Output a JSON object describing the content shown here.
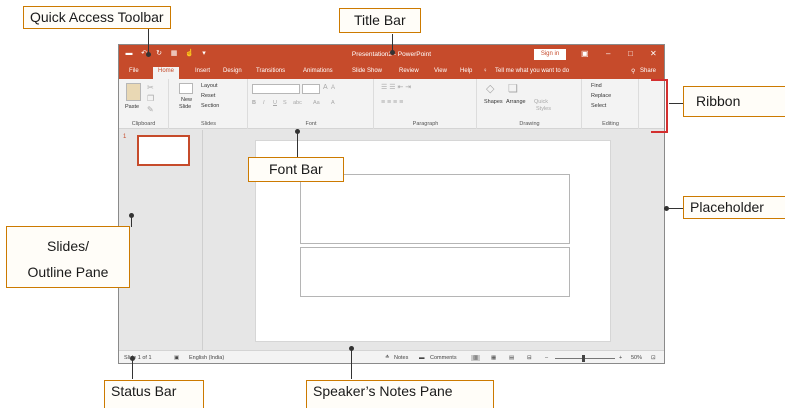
{
  "callouts": {
    "quick_access": "Quick  Access Toolbar",
    "title_bar": "Title Bar",
    "ribbon": "Ribbon",
    "placeholder": "Placeholder",
    "font_bar": "Font Bar",
    "slides_pane_line1": "Slides/",
    "slides_pane_line2": "Outline Pane",
    "status_bar": "Status Bar",
    "notes_pane": "Speaker’s Notes Pane"
  },
  "window": {
    "title": "Presentation2 - PowerPoint",
    "sign_in": "Sign in"
  },
  "tabs": [
    "File",
    "Home",
    "Insert",
    "Design",
    "Transitions",
    "Animations",
    "Slide Show",
    "Review",
    "View",
    "Help"
  ],
  "tell_me": "Tell me what you want to do",
  "share": "Share",
  "ribbon": {
    "clipboard": {
      "paste": "Paste",
      "label": "Clipboard"
    },
    "slides": {
      "new_slide_1": "New",
      "new_slide_2": "Slide",
      "layout": "Layout",
      "reset": "Reset",
      "section": "Section",
      "label": "Slides"
    },
    "font": {
      "label": "Font",
      "bold": "B",
      "italic": "I",
      "underline": "U",
      "strike": "S",
      "shadow": "abc",
      "aa": "Aa",
      "a": "A"
    },
    "paragraph": {
      "label": "Paragraph"
    },
    "drawing": {
      "shapes": "Shapes",
      "arrange": "Arrange",
      "quick_1": "Quick",
      "quick_2": "Styles",
      "label": "Drawing"
    },
    "editing": {
      "find": "Find",
      "replace": "Replace",
      "select": "Select",
      "label": "Editing"
    }
  },
  "thumbnail": {
    "number": "1"
  },
  "statusbar": {
    "slide_info": "Slide 1 of 1",
    "language": "English (India)",
    "notes": "Notes",
    "comments": "Comments",
    "zoom": "50%"
  },
  "colors": {
    "accent": "#c64b2b",
    "callout_border": "#cc7a00",
    "ribbon_bracket": "#d32f2f"
  }
}
